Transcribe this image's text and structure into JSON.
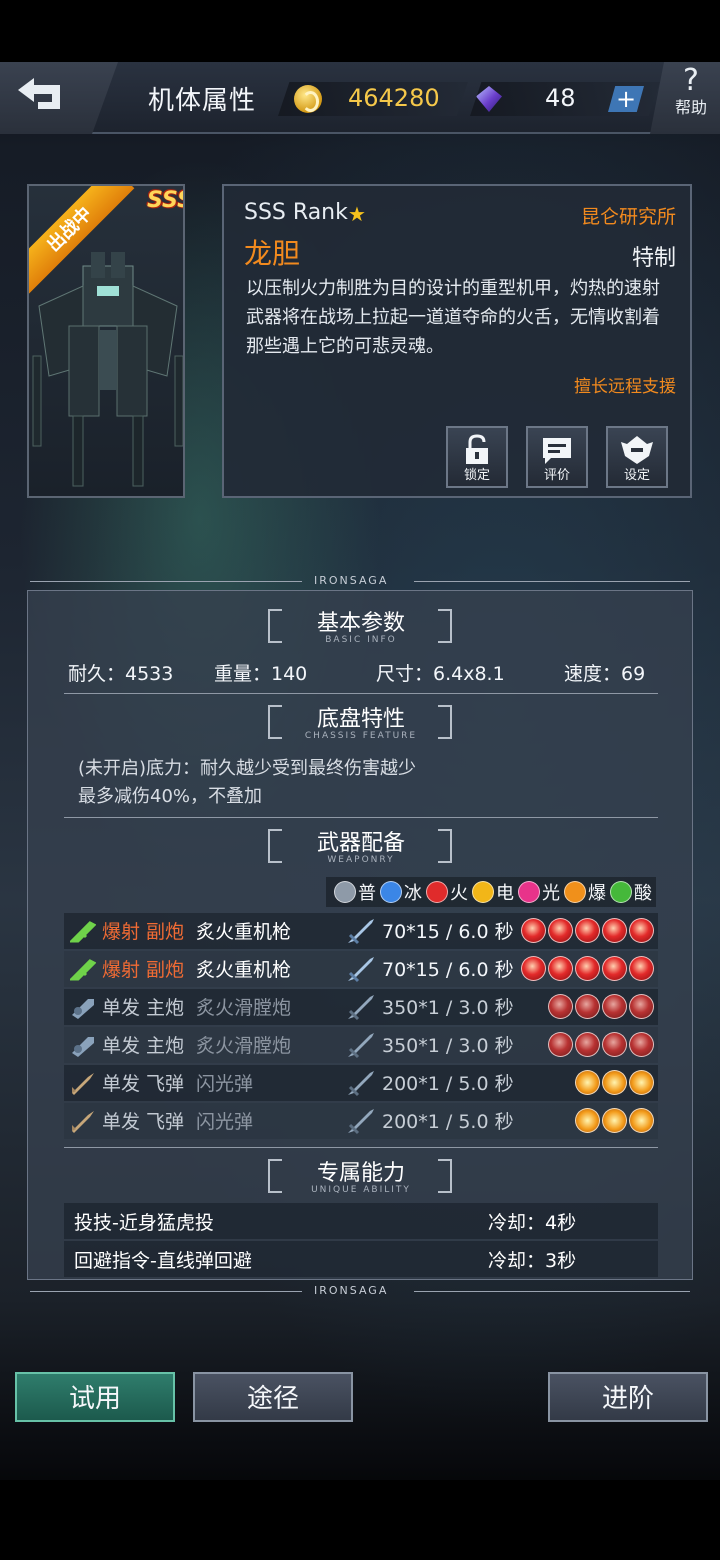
{
  "header": {
    "title": "机体属性",
    "gold": "464280",
    "gems": "48",
    "plus_label": "+",
    "help_label": "帮助",
    "help_glyph": "?"
  },
  "portrait": {
    "deploy_tag": "出战中",
    "rank_badge": "SSS"
  },
  "info": {
    "rank": "SSS Rank",
    "star": "★",
    "maker": "昆仑研究所",
    "name": "龙胆",
    "type": "特制",
    "description": "以压制火力制胜为目的设计的重型机甲，灼热的速射武器将在战场上拉起一道道夺命的火舌，无情收割着那些遇上它的可悲灵魂。",
    "specialty": "擅长远程支援",
    "buttons": {
      "lock": "锁定",
      "rate": "评价",
      "setup": "设定"
    }
  },
  "brand": {
    "top": "IRONSAGA",
    "bottom": "IRONSAGA",
    "side": "IRONSAGA"
  },
  "basic": {
    "title": "基本参数",
    "subtitle": "BASIC INFO",
    "durability": "耐久：4533",
    "weight": "重量：140",
    "size": "尺寸：6.4x8.1",
    "speed": "速度：69"
  },
  "chassis": {
    "title": "底盘特性",
    "subtitle": "CHASSIS FEATURE",
    "line1": "(未开启)底力：耐久越少受到最终伤害越少",
    "line2": "最多减伤40%，不叠加"
  },
  "weapons": {
    "title": "武器配备",
    "subtitle": "WEAPONRY",
    "legend": [
      {
        "label": "普",
        "color": "#8e9aa8"
      },
      {
        "label": "冰",
        "color": "#3b86e6"
      },
      {
        "label": "火",
        "color": "#e02b2b"
      },
      {
        "label": "电",
        "color": "#f2b618"
      },
      {
        "label": "光",
        "color": "#e8338a"
      },
      {
        "label": "爆",
        "color": "#f0901b"
      },
      {
        "label": "酸",
        "color": "#45b83a"
      }
    ],
    "rows": [
      {
        "kind": "爆射 副炮",
        "name": "炙火重机枪",
        "damage": "70*15 / 6.0 秒"
      },
      {
        "kind": "爆射 副炮",
        "name": "炙火重机枪",
        "damage": "70*15 / 6.0 秒"
      },
      {
        "kind": "单发 主炮",
        "name": "炙火滑膛炮",
        "damage": "350*1 / 3.0 秒"
      },
      {
        "kind": "单发 主炮",
        "name": "炙火滑膛炮",
        "damage": "350*1 / 3.0 秒"
      },
      {
        "kind": "单发 飞弹",
        "name": "闪光弹",
        "damage": "200*1 / 5.0 秒"
      },
      {
        "kind": "单发 飞弹",
        "name": "闪光弹",
        "damage": "200*1 / 5.0 秒"
      }
    ]
  },
  "abilities": {
    "title": "专属能力",
    "subtitle": "UNIQUE ABILITY",
    "rows": [
      {
        "name": "投技-近身猛虎投",
        "cooldown": "冷却：4秒"
      },
      {
        "name": "回避指令-直线弹回避",
        "cooldown": "冷却：3秒"
      }
    ]
  },
  "actions": {
    "try": "试用",
    "route": "途径",
    "advance": "进阶"
  }
}
